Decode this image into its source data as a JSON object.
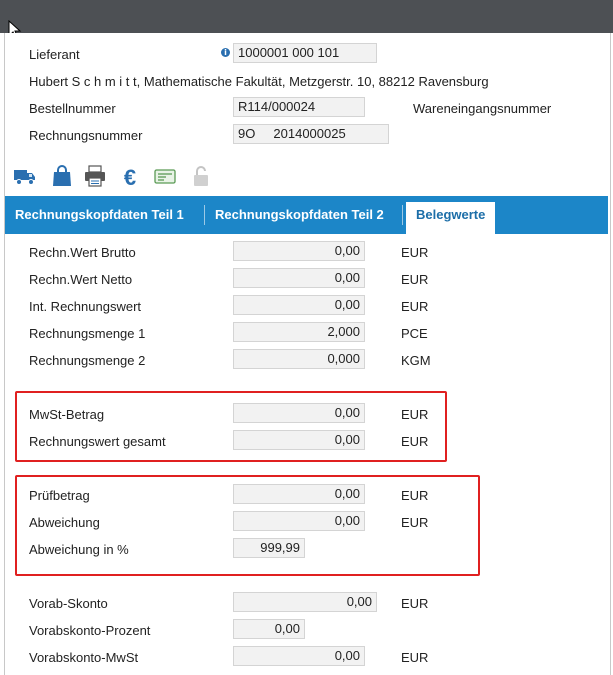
{
  "header": {
    "lieferant_label": "Lieferant",
    "lieferant_value": "1000001 000 101",
    "address": "Hubert S c h m i t t, Mathematische Fakultät, Metzgerstr. 10, 88212 Ravensburg",
    "bestellnummer_label": "Bestellnummer",
    "bestellnummer_value": "R114/000024",
    "wareneingang_label": "Wareneingangsnummer",
    "rechnungsnummer_label": "Rechnungsnummer",
    "rechnungsnummer_value": "9O     2014000025"
  },
  "toolbar": {
    "icons": [
      "truck-icon",
      "shopping-bag-icon",
      "printer-icon",
      "euro-icon",
      "card-icon",
      "lock-icon"
    ]
  },
  "tabs": [
    {
      "label": "Rechnungskopfdaten Teil 1"
    },
    {
      "label": "Rechnungskopfdaten Teil 2"
    },
    {
      "label": "Belegwerte",
      "active": true
    }
  ],
  "values": {
    "brutto": {
      "label": "Rechn.Wert Brutto",
      "value": "0,00",
      "unit": "EUR"
    },
    "netto": {
      "label": "Rechn.Wert Netto",
      "value": "0,00",
      "unit": "EUR"
    },
    "int": {
      "label": "Int. Rechnungswert",
      "value": "0,00",
      "unit": "EUR"
    },
    "menge1": {
      "label": "Rechnungsmenge 1",
      "value": "2,000",
      "unit": "PCE"
    },
    "menge2": {
      "label": "Rechnungsmenge 2",
      "value": "0,000",
      "unit": "KGM"
    },
    "mwst": {
      "label": "MwSt-Betrag",
      "value": "0,00",
      "unit": "EUR"
    },
    "gesamt": {
      "label": "Rechnungswert gesamt",
      "value": "0,00",
      "unit": "EUR"
    },
    "pruef": {
      "label": "Prüfbetrag",
      "value": "0,00",
      "unit": "EUR"
    },
    "abw": {
      "label": "Abweichung",
      "value": "0,00",
      "unit": "EUR"
    },
    "abwproz": {
      "label": "Abweichung in %",
      "value": "999,99"
    },
    "skonto": {
      "label": "Vorab-Skonto",
      "value": "0,00",
      "unit": "EUR"
    },
    "skontoproz": {
      "label": "Vorabskonto-Prozent",
      "value": "0,00"
    },
    "skontomwst": {
      "label": "Vorabskonto-MwSt",
      "value": "0,00",
      "unit": "EUR"
    }
  },
  "colors": {
    "tabbar": "#1c86c8",
    "highlight": "#e02020",
    "topbar": "#4d5054"
  }
}
